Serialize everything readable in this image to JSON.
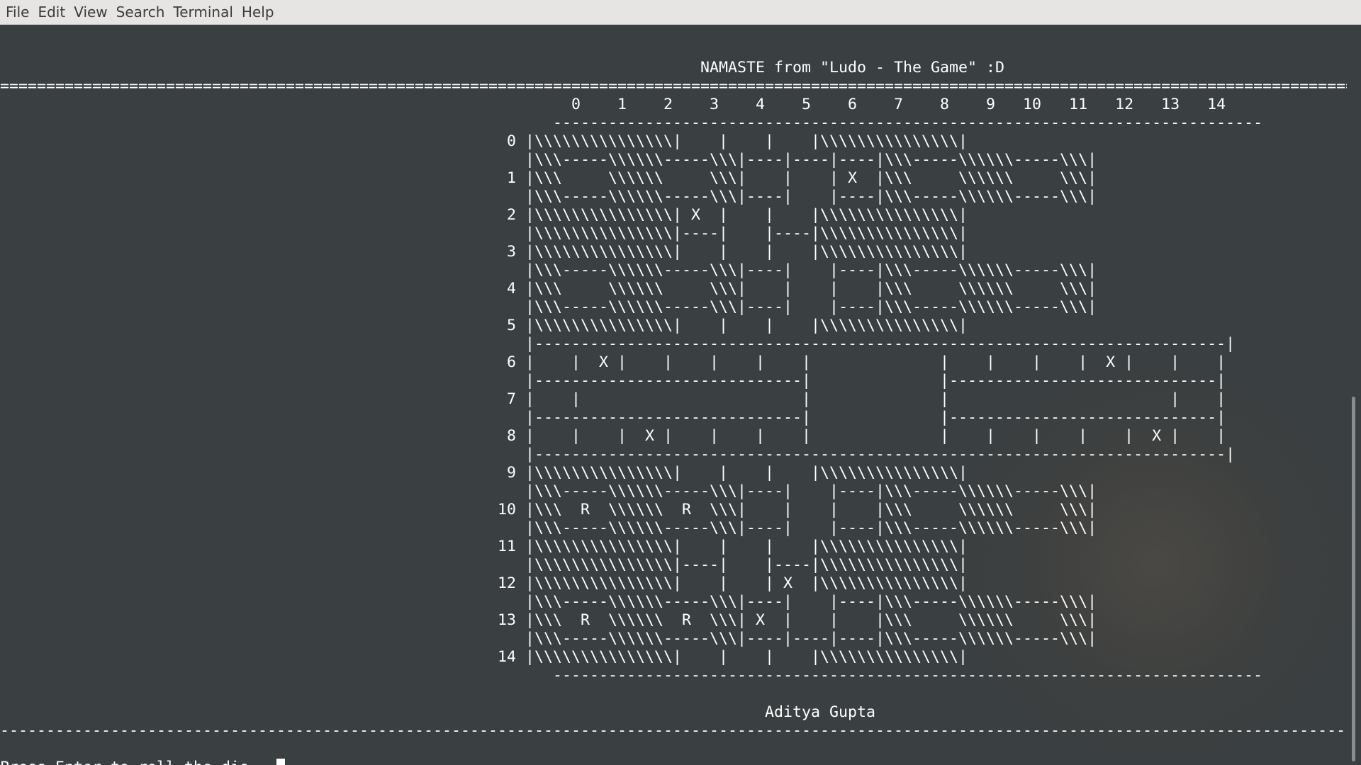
{
  "menu": {
    "items": [
      "File",
      "Edit",
      "View",
      "Search",
      "Terminal",
      "Help"
    ]
  },
  "terminal": {
    "lines": [
      "",
      "                                                                            NAMASTE from \"Ludo - The Game\" :D",
      "=================================================================================================================================================================================================",
      "                                                              0    1    2    3    4    5    6    7    8    9   10   11   12   13   14",
      "                                                            -----------------------------------------------------------------------------",
      "                                                       0 |\\\\\\\\\\\\\\\\\\\\\\\\\\\\\\|    |    |    |\\\\\\\\\\\\\\\\\\\\\\\\\\\\\\|",
      "                                                         |\\\\\\-----\\\\\\\\\\\\-----\\\\\\|----|----|----|\\\\\\-----\\\\\\\\\\\\-----\\\\\\|",
      "                                                       1 |\\\\\\     \\\\\\\\\\\\     \\\\\\|    |    | X  |\\\\\\     \\\\\\\\\\\\     \\\\\\|",
      "                                                         |\\\\\\-----\\\\\\\\\\\\-----\\\\\\|----|    |----|\\\\\\-----\\\\\\\\\\\\-----\\\\\\|",
      "                                                       2 |\\\\\\\\\\\\\\\\\\\\\\\\\\\\\\| X  |    |    |\\\\\\\\\\\\\\\\\\\\\\\\\\\\\\|",
      "                                                         |\\\\\\\\\\\\\\\\\\\\\\\\\\\\\\|----|    |----|\\\\\\\\\\\\\\\\\\\\\\\\\\\\\\|",
      "                                                       3 |\\\\\\\\\\\\\\\\\\\\\\\\\\\\\\|    |    |    |\\\\\\\\\\\\\\\\\\\\\\\\\\\\\\|",
      "                                                         |\\\\\\-----\\\\\\\\\\\\-----\\\\\\|----|    |----|\\\\\\-----\\\\\\\\\\\\-----\\\\\\|",
      "                                                       4 |\\\\\\     \\\\\\\\\\\\     \\\\\\|    |    |    |\\\\\\     \\\\\\\\\\\\     \\\\\\|",
      "                                                         |\\\\\\-----\\\\\\\\\\\\-----\\\\\\|----|    |----|\\\\\\-----\\\\\\\\\\\\-----\\\\\\|",
      "                                                       5 |\\\\\\\\\\\\\\\\\\\\\\\\\\\\\\|    |    |    |\\\\\\\\\\\\\\\\\\\\\\\\\\\\\\|",
      "                                                         |---------------------------------------------------------------------------|",
      "                                                       6 |    |  X |    |    |    |    |              |    |    |    |  X |    |    |",
      "                                                         |-----------------------------|              |-----------------------------|",
      "                                                       7 |    |                        |              |                        |    |",
      "                                                         |-----------------------------|              |-----------------------------|",
      "                                                       8 |    |    |  X |    |    |    |              |    |    |    |    |  X |    |",
      "                                                         |---------------------------------------------------------------------------|",
      "                                                       9 |\\\\\\\\\\\\\\\\\\\\\\\\\\\\\\|    |    |    |\\\\\\\\\\\\\\\\\\\\\\\\\\\\\\|",
      "                                                         |\\\\\\-----\\\\\\\\\\\\-----\\\\\\|----|    |----|\\\\\\-----\\\\\\\\\\\\-----\\\\\\|",
      "                                                      10 |\\\\\\  R  \\\\\\\\\\\\  R  \\\\\\|    |    |    |\\\\\\     \\\\\\\\\\\\     \\\\\\|",
      "                                                         |\\\\\\-----\\\\\\\\\\\\-----\\\\\\|----|    |----|\\\\\\-----\\\\\\\\\\\\-----\\\\\\|",
      "                                                      11 |\\\\\\\\\\\\\\\\\\\\\\\\\\\\\\|    |    |    |\\\\\\\\\\\\\\\\\\\\\\\\\\\\\\|",
      "                                                         |\\\\\\\\\\\\\\\\\\\\\\\\\\\\\\|----|    |----|\\\\\\\\\\\\\\\\\\\\\\\\\\\\\\|",
      "                                                      12 |\\\\\\\\\\\\\\\\\\\\\\\\\\\\\\|    |    | X  |\\\\\\\\\\\\\\\\\\\\\\\\\\\\\\|",
      "                                                         |\\\\\\-----\\\\\\\\\\\\-----\\\\\\|----|    |----|\\\\\\-----\\\\\\\\\\\\-----\\\\\\|",
      "                                                      13 |\\\\\\  R  \\\\\\\\\\\\  R  \\\\\\| X  |    |    |\\\\\\     \\\\\\\\\\\\     \\\\\\|",
      "                                                         |\\\\\\-----\\\\\\\\\\\\-----\\\\\\|----|----|----|\\\\\\-----\\\\\\\\\\\\-----\\\\\\|",
      "                                                      14 |\\\\\\\\\\\\\\\\\\\\\\\\\\\\\\|    |    |    |\\\\\\\\\\\\\\\\\\\\\\\\\\\\\\|",
      "                                                            -----------------------------------------------------------------------------",
      "",
      "                                                                                   Aditya Gupta",
      "-------------------------------------------------------------------------------------------------------------------------------------------------------------------------------------------------",
      ""
    ],
    "prompt": "Press Enter to roll the die..."
  }
}
